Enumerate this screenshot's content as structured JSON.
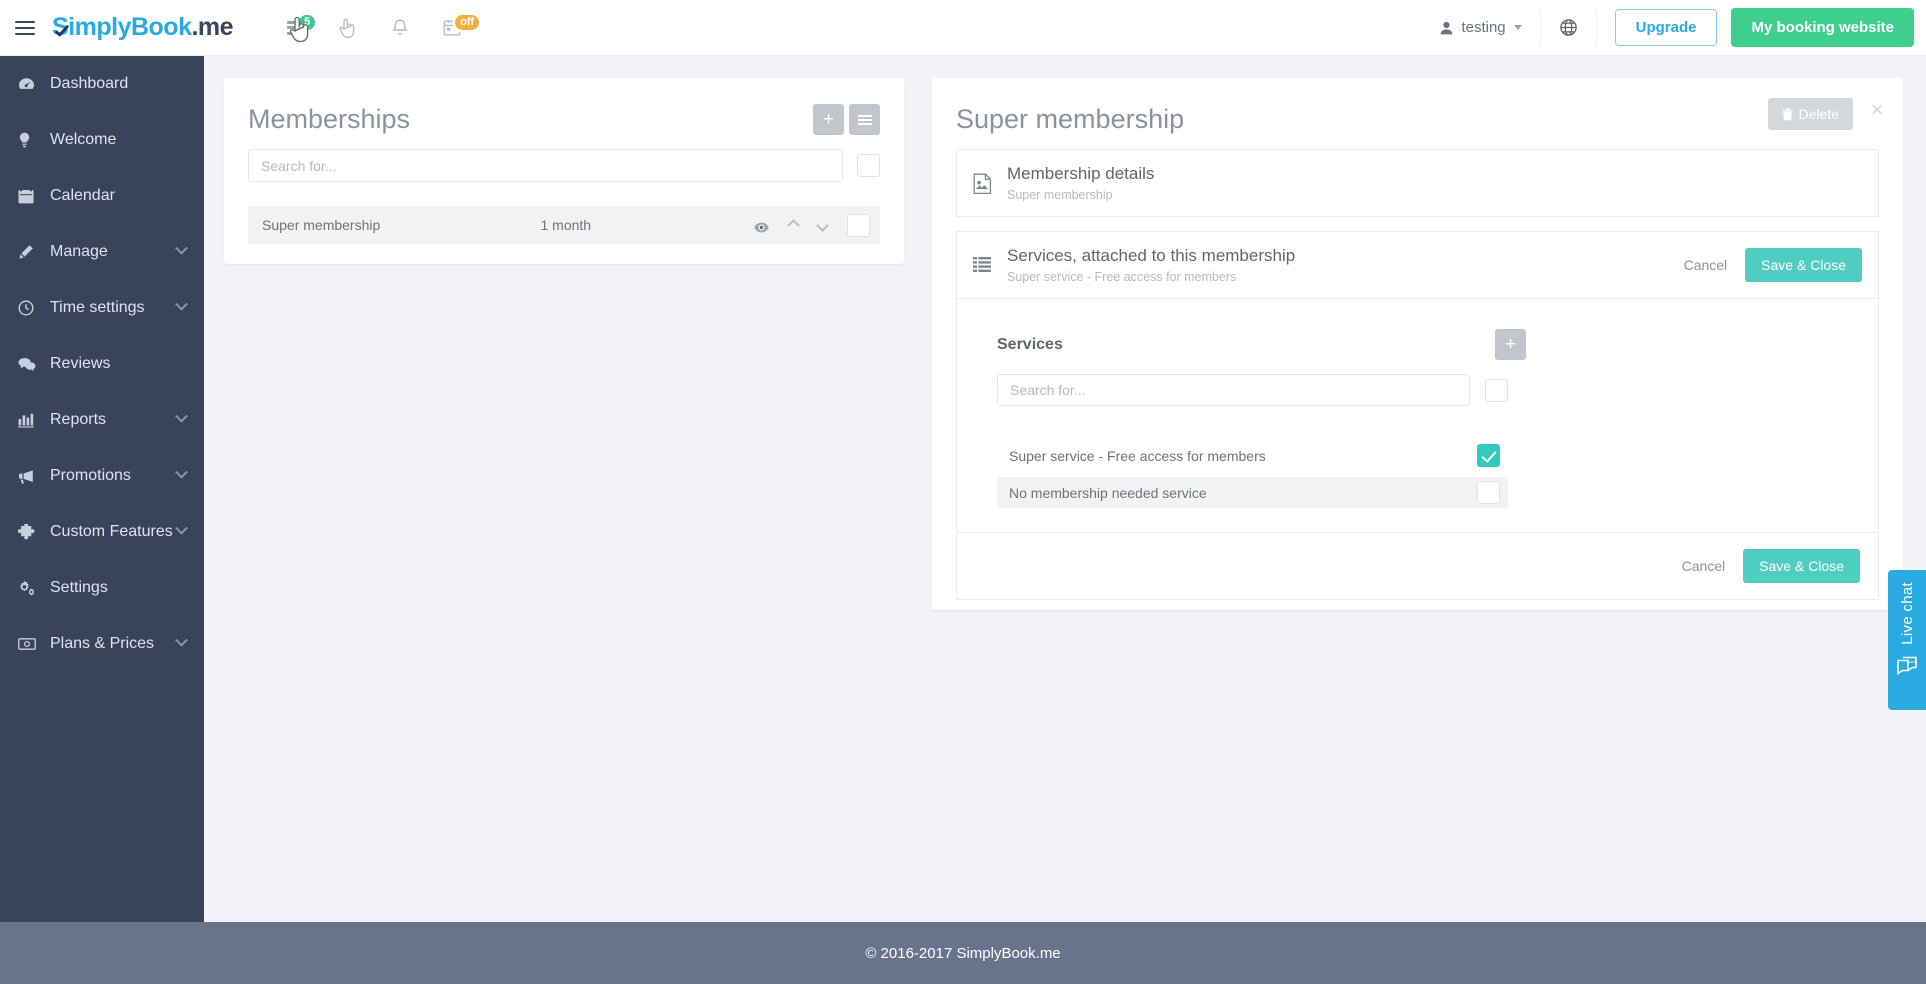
{
  "brand": {
    "name": "Simply",
    "name2": "Book",
    "suffix": ".me"
  },
  "topbar": {
    "icons": [
      {
        "name": "notes-icon",
        "badge": "5",
        "badge_color": "#3ec98f"
      },
      {
        "name": "hand-cursor-icon",
        "badge": ""
      },
      {
        "name": "bell-icon",
        "badge": ""
      },
      {
        "name": "calendar-icon",
        "badge": "off",
        "badge_color": "#f5ad3c"
      }
    ],
    "user": "testing",
    "upgrade_label": "Upgrade",
    "booking_label": "My booking website"
  },
  "sidebar": {
    "items": [
      {
        "label": "Dashboard",
        "icon": "dashboard-icon",
        "chevron": false
      },
      {
        "label": "Welcome",
        "icon": "lightbulb-icon",
        "chevron": false
      },
      {
        "label": "Calendar",
        "icon": "calendar-icon",
        "chevron": false
      },
      {
        "label": "Manage",
        "icon": "pencil-icon",
        "chevron": true
      },
      {
        "label": "Time settings",
        "icon": "clock-icon",
        "chevron": true
      },
      {
        "label": "Reviews",
        "icon": "comments-icon",
        "chevron": false
      },
      {
        "label": "Reports",
        "icon": "bar-chart-icon",
        "chevron": true
      },
      {
        "label": "Promotions",
        "icon": "megaphone-icon",
        "chevron": true
      },
      {
        "label": "Custom Features",
        "icon": "puzzle-icon",
        "chevron": true
      },
      {
        "label": "Settings",
        "icon": "gears-icon",
        "chevron": false
      },
      {
        "label": "Plans & Prices",
        "icon": "money-icon",
        "chevron": true
      }
    ]
  },
  "memberships_panel": {
    "title": "Memberships",
    "add_label": "+",
    "search_placeholder": "Search for...",
    "search_value": "",
    "rows": [
      {
        "name": "Super membership",
        "duration": "1 month",
        "checked": false
      }
    ]
  },
  "detail_panel": {
    "title": "Super membership",
    "delete_label": "Delete",
    "close_label": "×",
    "sections": [
      {
        "title": "Membership details",
        "subtitle": "Super membership",
        "icon": "document-image-icon",
        "expanded": false
      },
      {
        "title": "Services, attached to this membership",
        "subtitle": "Super service - Free access for members",
        "icon": "list-icon",
        "expanded": true,
        "cancel_label": "Cancel",
        "save_label": "Save & Close"
      }
    ],
    "services": {
      "heading": "Services",
      "add_label": "+",
      "search_placeholder": "Search for...",
      "search_value": "",
      "select_all_checked": false,
      "items": [
        {
          "label": "Super service - Free access for members",
          "checked": true,
          "alt": false
        },
        {
          "label": "No membership needed service",
          "checked": false,
          "alt": true
        }
      ]
    },
    "footer": {
      "cancel_label": "Cancel",
      "save_label": "Save & Close"
    }
  },
  "livechat": {
    "label": "Live chat",
    "icon": "chat-bubble-icon",
    "color": "#29abe2"
  },
  "footer": {
    "text": "© 2016-2017 SimplyBook.me"
  },
  "colors": {
    "teal": "#4ecdc4",
    "green": "#3ecf8e",
    "blue": "#29abe2",
    "sidebar": "#39435c",
    "footer": "#68738c"
  }
}
